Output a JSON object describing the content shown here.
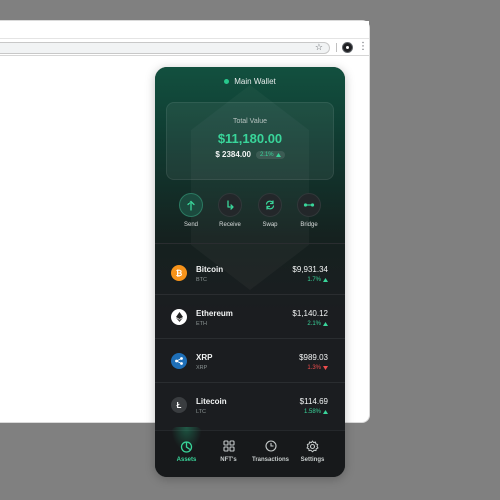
{
  "browser": {
    "star_icon": "star-icon",
    "profile_icon": "profile-icon",
    "menu_icon": "kebab-menu-icon"
  },
  "wallet": {
    "title": "Main Wallet",
    "total_label": "Total Value",
    "total_value": "$11,180.00",
    "change_amount": "$ 2384.00",
    "change_percent": "2.1%"
  },
  "actions": [
    {
      "label": "Send",
      "icon": "send-arrow-icon"
    },
    {
      "label": "Receive",
      "icon": "receive-arrow-icon"
    },
    {
      "label": "Swap",
      "icon": "swap-icon"
    },
    {
      "label": "Bridge",
      "icon": "bridge-icon"
    }
  ],
  "assets": [
    {
      "name": "Bitcoin",
      "ticker": "BTC",
      "price": "$9,931.34",
      "change": "1.7%",
      "direction": "up",
      "icon_color": "#f7931a",
      "icon_glyph": "₿"
    },
    {
      "name": "Ethereum",
      "ticker": "ETH",
      "price": "$1,140.12",
      "change": "2.1%",
      "direction": "up",
      "icon_color": "#ffffff",
      "icon_glyph": "◆"
    },
    {
      "name": "XRP",
      "ticker": "XRP",
      "price": "$989.03",
      "change": "1.3%",
      "direction": "down",
      "icon_color": "#1e6fb8",
      "icon_glyph": "✕"
    },
    {
      "name": "Litecoin",
      "ticker": "LTC",
      "price": "$114.69",
      "change": "1.58%",
      "direction": "up",
      "icon_color": "#3a3d40",
      "icon_glyph": "Ł"
    }
  ],
  "tabs": [
    {
      "label": "Assets",
      "icon": "pie-chart-icon",
      "active": true
    },
    {
      "label": "NFT's",
      "icon": "grid-icon",
      "active": false
    },
    {
      "label": "Transactions",
      "icon": "clock-icon",
      "active": false
    },
    {
      "label": "Settings",
      "icon": "gear-icon",
      "active": false
    }
  ],
  "colors": {
    "accent": "#39d59a",
    "negative": "#ef4d4d",
    "background": "#1b1d20"
  }
}
